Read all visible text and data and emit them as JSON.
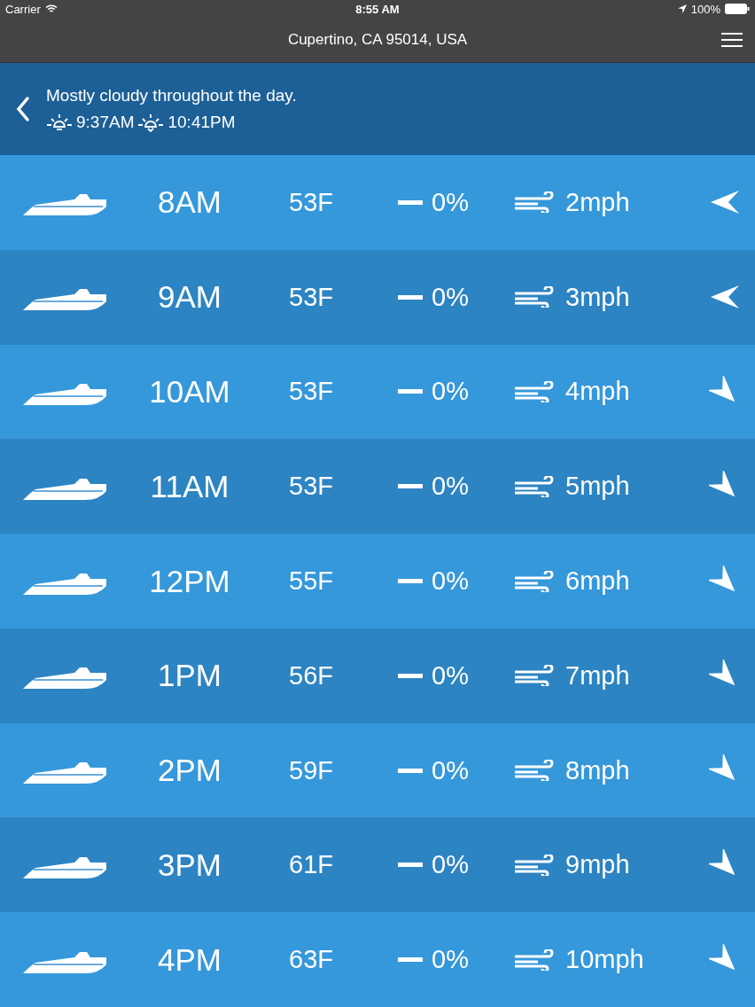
{
  "status_bar": {
    "carrier": "Carrier",
    "time": "8:55 AM",
    "battery": "100%"
  },
  "nav": {
    "title": "Cupertino, CA 95014, USA"
  },
  "summary": {
    "text": "Mostly cloudy throughout the day.",
    "sunrise": "9:37AM",
    "sunset": "10:41PM"
  },
  "rows": [
    {
      "time": "8AM",
      "temp": "53F",
      "precip": "0%",
      "wind": "2mph",
      "kind": "left"
    },
    {
      "time": "9AM",
      "temp": "53F",
      "precip": "0%",
      "wind": "3mph",
      "kind": "left"
    },
    {
      "time": "10AM",
      "temp": "53F",
      "precip": "0%",
      "wind": "4mph",
      "kind": "diagonal"
    },
    {
      "time": "11AM",
      "temp": "53F",
      "precip": "0%",
      "wind": "5mph",
      "kind": "diagonal"
    },
    {
      "time": "12PM",
      "temp": "55F",
      "precip": "0%",
      "wind": "6mph",
      "kind": "diagonal"
    },
    {
      "time": "1PM",
      "temp": "56F",
      "precip": "0%",
      "wind": "7mph",
      "kind": "diagonal"
    },
    {
      "time": "2PM",
      "temp": "59F",
      "precip": "0%",
      "wind": "8mph",
      "kind": "diagonal"
    },
    {
      "time": "3PM",
      "temp": "61F",
      "precip": "0%",
      "wind": "9mph",
      "kind": "diagonal"
    },
    {
      "time": "4PM",
      "temp": "63F",
      "precip": "0%",
      "wind": "10mph",
      "kind": "diagonal"
    }
  ]
}
